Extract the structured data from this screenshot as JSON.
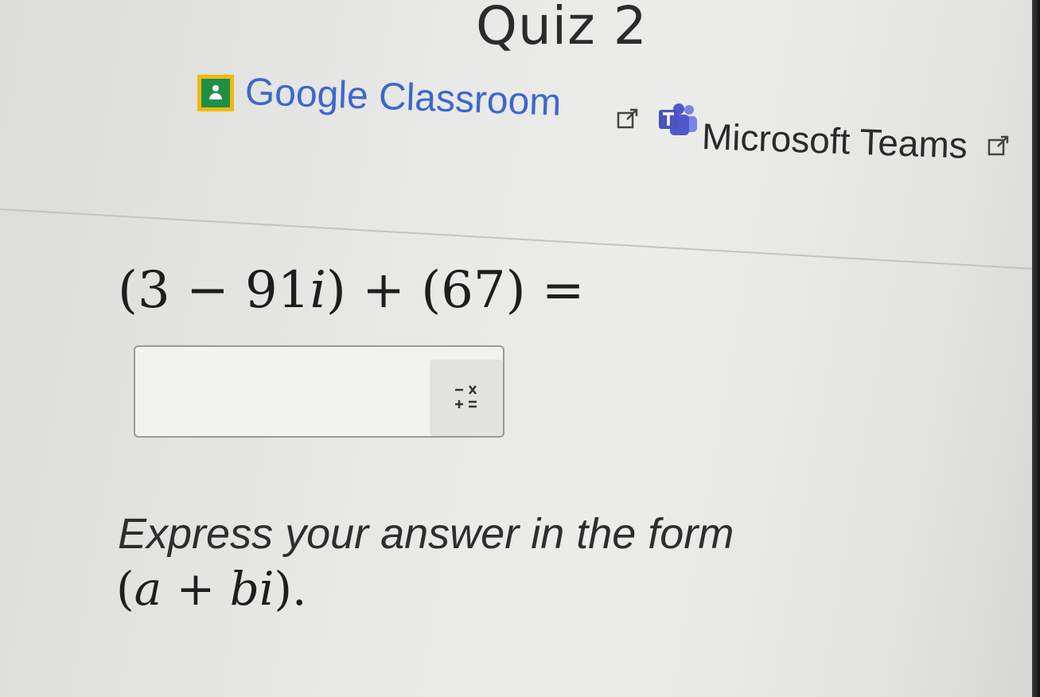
{
  "quiz": {
    "title": "Quiz 2"
  },
  "share": {
    "google_classroom_label": "Google Classroom",
    "google_classroom_icon": "google-classroom-icon",
    "microsoft_teams_label": "Microsoft Teams",
    "microsoft_teams_icon": "microsoft-teams-icon",
    "external_link_icon": "external-link-icon"
  },
  "problem": {
    "open_paren": "(",
    "term_real": "3",
    "minus": " − ",
    "term_imag_coef": "91",
    "term_imag_var": "i",
    "close_paren_plus": ") + (",
    "term_second": "67",
    "close_equals": ") ="
  },
  "answer": {
    "value": "",
    "placeholder": "",
    "keypad_icon": "math-keypad-icon"
  },
  "instructions": {
    "text": "Express your answer in the form",
    "form_open": "(",
    "form_a": "a",
    "form_plus": " + ",
    "form_b": "b",
    "form_i": "i",
    "form_close": ")."
  },
  "colors": {
    "link_blue": "#3c68cc",
    "classroom_yellow": "#f1b90a",
    "classroom_green": "#1f8f48",
    "teams_purple": "#5059c9"
  }
}
